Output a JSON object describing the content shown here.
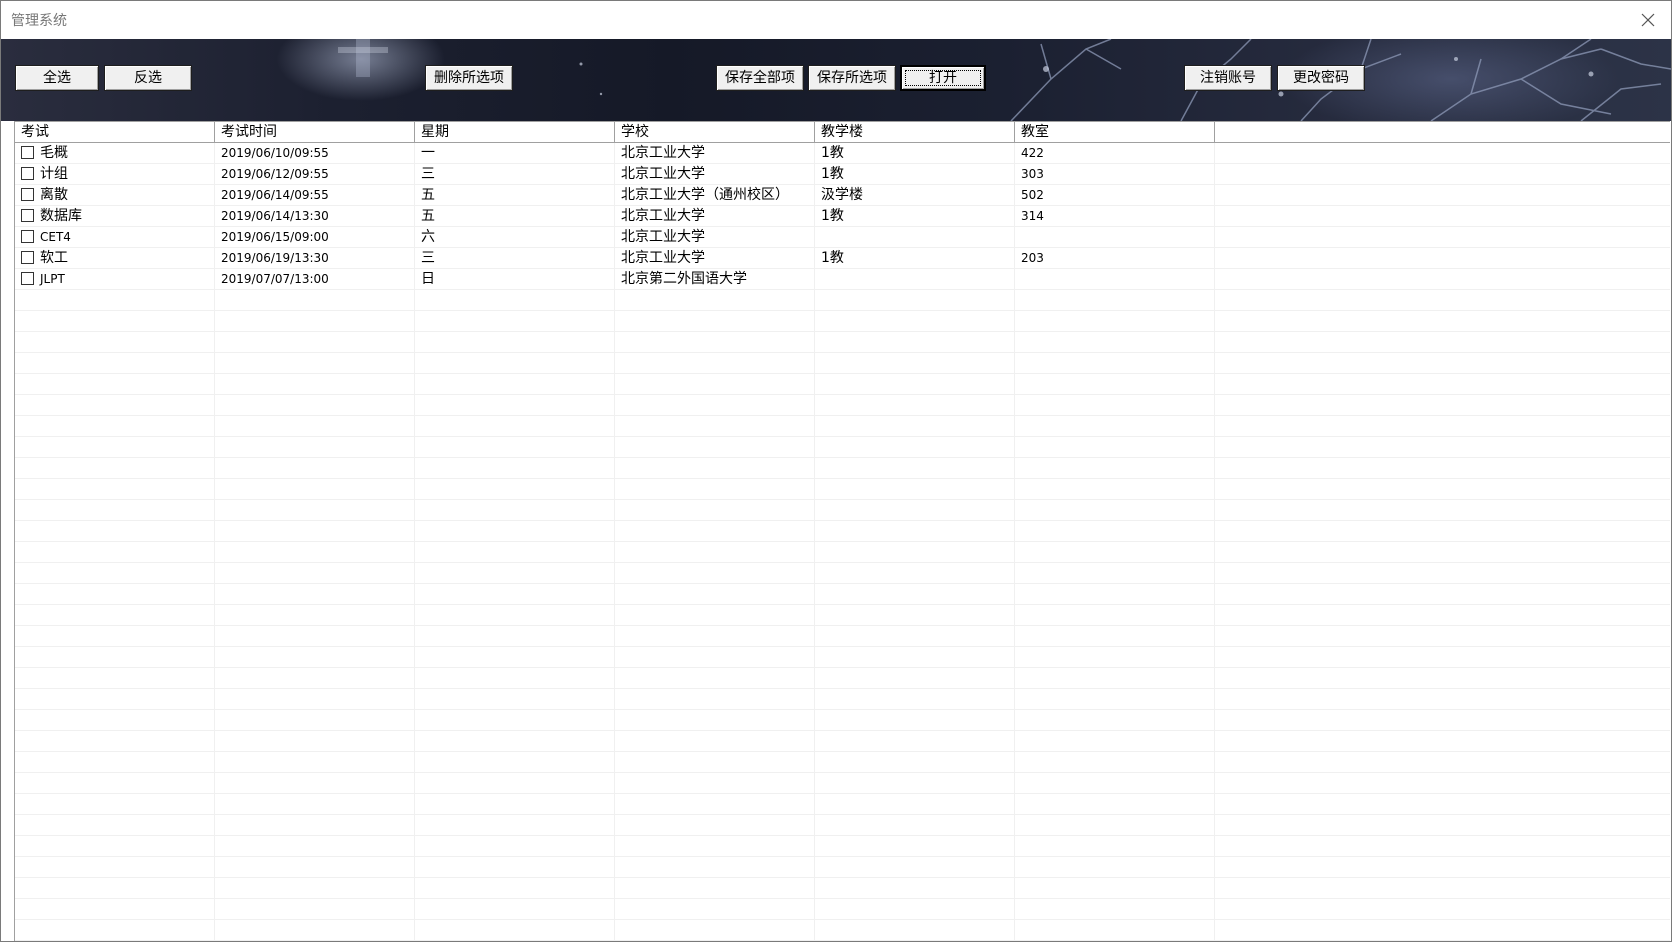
{
  "window": {
    "title": "管理系统"
  },
  "toolbar": {
    "select_all": "全选",
    "invert_selection": "反选",
    "delete_selected": "删除所选项",
    "save_all": "保存全部项",
    "save_selected": "保存所选项",
    "open": "打开",
    "logout": "注销账号",
    "change_password": "更改密码"
  },
  "table": {
    "columns": [
      "考试",
      "考试时间",
      "星期",
      "学校",
      "教学楼",
      "教室"
    ],
    "rows": [
      {
        "exam": "毛概",
        "time": "2019/06/10/09:55",
        "weekday": "一",
        "school": "北京工业大学",
        "building": "1教",
        "room": "422",
        "checked": false
      },
      {
        "exam": "计组",
        "time": "2019/06/12/09:55",
        "weekday": "三",
        "school": "北京工业大学",
        "building": "1教",
        "room": "303",
        "checked": false
      },
      {
        "exam": "离散",
        "time": "2019/06/14/09:55",
        "weekday": "五",
        "school": "北京工业大学（通州校区）",
        "building": "汲学楼",
        "room": "502",
        "checked": false
      },
      {
        "exam": "数据库",
        "time": "2019/06/14/13:30",
        "weekday": "五",
        "school": "北京工业大学",
        "building": "1教",
        "room": "314",
        "checked": false
      },
      {
        "exam": "CET4",
        "time": "2019/06/15/09:00",
        "weekday": "六",
        "school": "北京工业大学",
        "building": "",
        "room": "",
        "checked": false
      },
      {
        "exam": "软工",
        "time": "2019/06/19/13:30",
        "weekday": "三",
        "school": "北京工业大学",
        "building": "1教",
        "room": "203",
        "checked": false
      },
      {
        "exam": "JLPT",
        "time": "2019/07/07/13:00",
        "weekday": "日",
        "school": "北京第二外国语大学",
        "building": "",
        "room": "",
        "checked": false
      }
    ]
  },
  "icons": {
    "close": "close-icon",
    "checkbox": "checkbox-icon"
  },
  "colors": {
    "banner_dark": "#1c2030",
    "grid_line": "#f0f0f0",
    "header_border": "#a0a0a0",
    "button_face": "#f0f0f0"
  }
}
